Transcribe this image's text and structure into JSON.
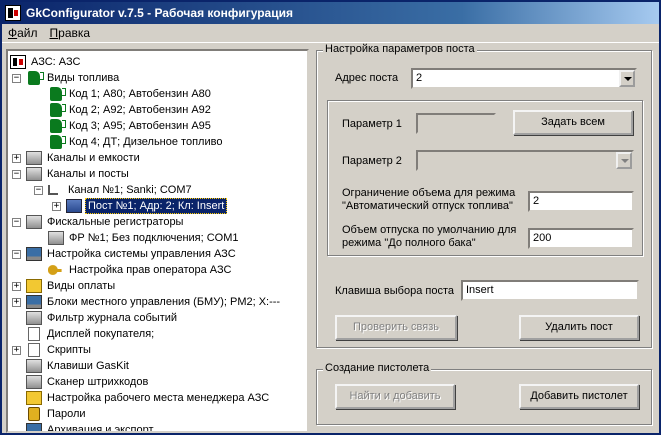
{
  "window": {
    "title": "GkConfigurator v.7.5  -  Рабочая конфигурация"
  },
  "menu": {
    "file": "Файл",
    "edit": "Правка"
  },
  "tree": {
    "root": "АЗС: АЗС",
    "fuel_types": "Виды топлива",
    "fuel_1": "Код 1; А80; Автобензин А80",
    "fuel_2": "Код 2; А92; Автобензин А92",
    "fuel_3": "Код 3; А95; Автобензин А95",
    "fuel_4": "Код 4; ДТ; Дизельное топливо",
    "channels_tanks": "Каналы и емкости",
    "channels_posts": "Каналы и посты",
    "channel_1": "Канал №1; Sanki; COM7",
    "post_1": "Пост №1; Адр: 2; Кл: Insert",
    "fiscal": "Фискальные регистраторы",
    "fr_1": "ФР №1; Без подключения; COM1",
    "control_setup": "Настройка системы управления АЗС",
    "operator_rights": "Настройка прав оператора АЗС",
    "payment": "Виды оплаты",
    "bmu": "Блоки местного управления (БМУ);  PM2;  X:---",
    "log_filter": "Фильтр журнала событий",
    "buyer_display": "Дисплей покупателя;",
    "scripts": "Скрипты",
    "gaskit_keys": "Клавиши GasKit",
    "barcode": "Сканер штрихкодов",
    "manager_ws": "Настройка рабочего места менеджера АЗС",
    "passwords": "Пароли",
    "archive": "Архивация и экспорт"
  },
  "post_settings": {
    "legend": "Настройка параметров поста",
    "address_label": "Адрес поста",
    "address_value": "2",
    "param1_label": "Параметр 1",
    "param1_value": "",
    "set_all_button": "Задать всем",
    "param2_label": "Параметр 2",
    "param2_value": "",
    "limit_label_1": "Ограничение объема для режима",
    "limit_label_2": "\"Автоматический отпуск топлива\"",
    "limit_value": "2",
    "default_label_1": "Объем отпуска по умолчанию для",
    "default_label_2": "режима \"До полного бака\"",
    "default_value": "200",
    "key_label": "Клавиша выбора поста",
    "key_value": "Insert",
    "check_button": "Проверить связь",
    "delete_button": "Удалить пост"
  },
  "nozzle": {
    "legend": "Создание пистолета",
    "find_button": "Найти и добавить",
    "add_button": "Добавить пистолет"
  }
}
